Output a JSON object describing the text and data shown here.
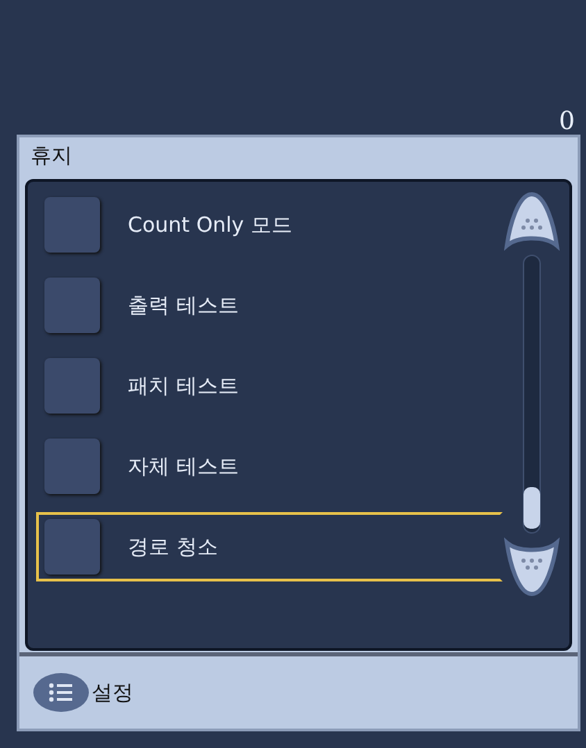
{
  "counter": "0",
  "panel": {
    "title": "휴지",
    "items": [
      {
        "label": "Count Only 모드",
        "checked": false,
        "selected": false
      },
      {
        "label": "출력 테스트",
        "checked": false,
        "selected": false
      },
      {
        "label": "패치 테스트",
        "checked": false,
        "selected": false
      },
      {
        "label": "자체 테스트",
        "checked": false,
        "selected": false
      },
      {
        "label": "경로 청소",
        "checked": false,
        "selected": true
      }
    ]
  },
  "footer": {
    "button": "설정"
  }
}
